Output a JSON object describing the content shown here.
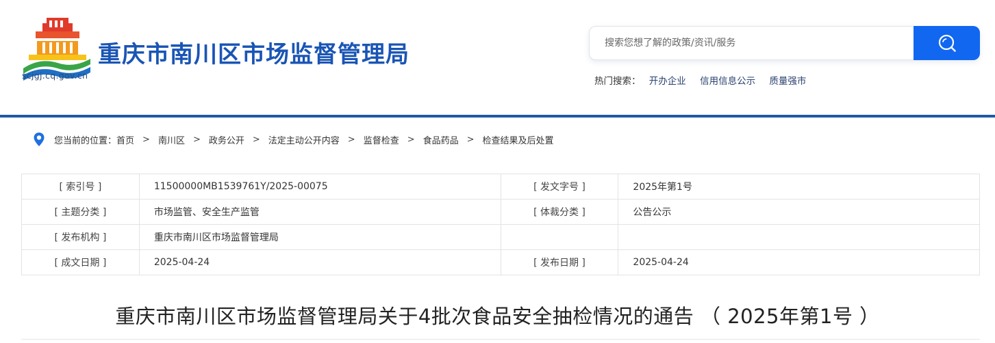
{
  "header": {
    "site_title": "重庆市南川区市场监督管理局",
    "logo_url": "scjgj.cq.gov.cn",
    "search": {
      "placeholder": "搜索您想了解的政策/资讯/服务"
    },
    "hot_search": {
      "label": "热门搜索：",
      "links": [
        "开办企业",
        "信用信息公示",
        "质量强市"
      ]
    }
  },
  "breadcrumb": {
    "prefix": "您当前的位置：",
    "items": [
      "首页",
      "南川区",
      "政务公开",
      "法定主动公开内容",
      "监督检查",
      "食品药品",
      "检查结果及后处置"
    ],
    "separator": ">"
  },
  "meta": {
    "rows": [
      {
        "k1": "[ 索引号 ]",
        "v1": "11500000MB1539761Y/2025-00075",
        "k2": "[ 发文字号 ]",
        "v2": "2025年第1号"
      },
      {
        "k1": "[ 主题分类 ]",
        "v1": "市场监管、安全生产监管",
        "k2": "[ 体裁分类 ]",
        "v2": "公告公示"
      },
      {
        "k1": "[ 发布机构 ]",
        "v1": "重庆市南川区市场监督管理局",
        "k2": "",
        "v2": ""
      },
      {
        "k1": "[ 成文日期 ]",
        "v1": "2025-04-24",
        "k2": "[ 发布日期 ]",
        "v2": "2025-04-24"
      }
    ]
  },
  "document": {
    "title": "重庆市南川区市场监督管理局关于4批次食品安全抽检情况的通告 （ 2025年第1号 ）"
  },
  "colors": {
    "brand_blue": "#1a55b5",
    "search_button": "#1167f0",
    "header_rule": "#1d5aa8"
  },
  "icons": {
    "search": "search-icon",
    "location": "location-pin-icon",
    "logo": "emblem-logo-icon"
  }
}
